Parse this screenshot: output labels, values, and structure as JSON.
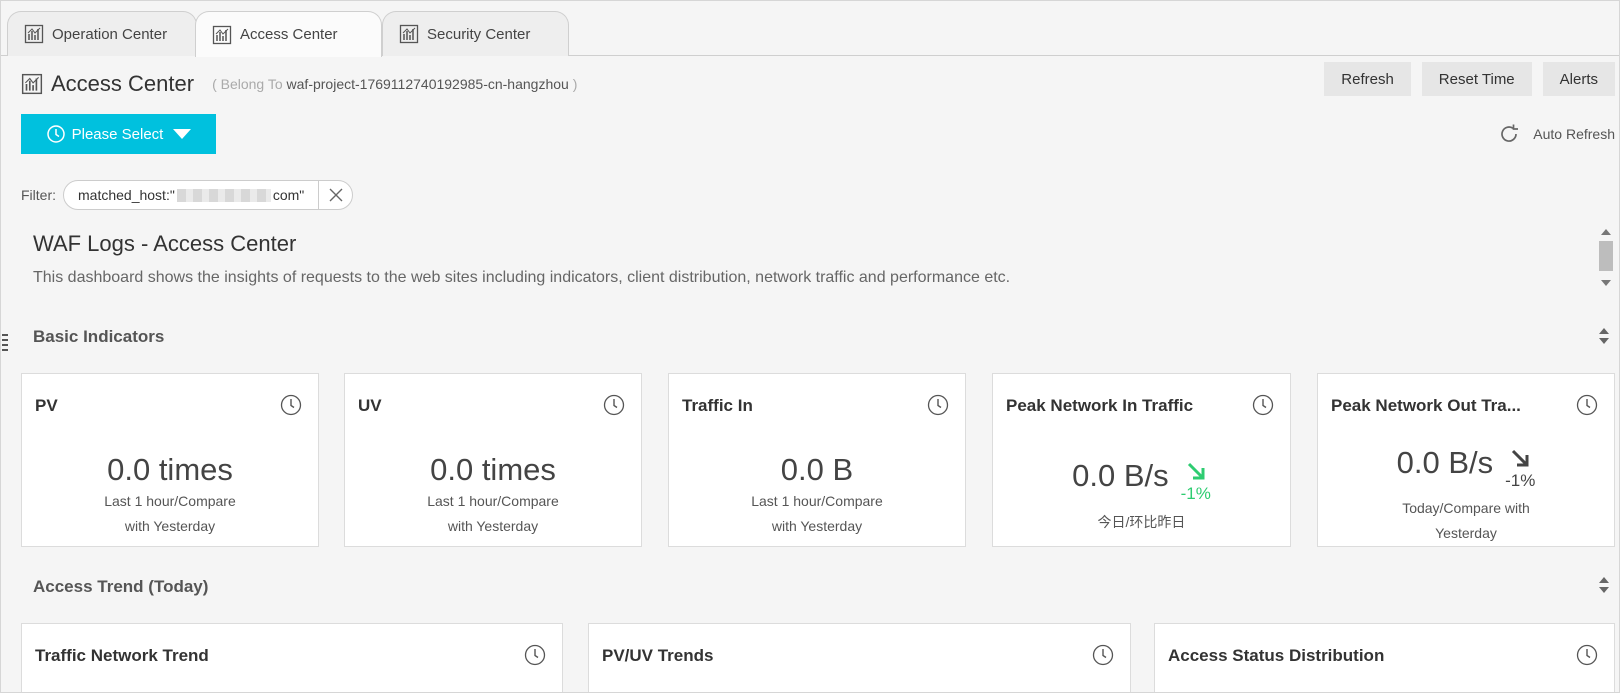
{
  "tabs": [
    {
      "label": "Operation Center",
      "active": false
    },
    {
      "label": "Access Center",
      "active": true
    },
    {
      "label": "Security Center",
      "active": false
    }
  ],
  "header": {
    "title": "Access Center",
    "belong_prefix": "( Belong To",
    "project": "waf-project-1769112740192985-cn-hangzhou",
    "belong_suffix": ")",
    "buttons": {
      "refresh": "Refresh",
      "reset_time": "Reset Time",
      "alerts": "Alerts"
    }
  },
  "time_select": {
    "label": "Please Select"
  },
  "auto_refresh": {
    "label": "Auto Refresh"
  },
  "filter": {
    "label": "Filter:",
    "chip_prefix": "matched_host:\"",
    "chip_suffix": "com\""
  },
  "dashboard": {
    "title": "WAF Logs - Access Center",
    "description": "This dashboard shows the insights of requests to the web sites including indicators, client distribution, network traffic and performance etc."
  },
  "sections": {
    "basic": "Basic Indicators",
    "trend": "Access Trend (Today)"
  },
  "indicators": [
    {
      "title": "PV",
      "value": "0.0 times",
      "sub1": "Last 1 hour/Compare",
      "sub2": "with Yesterday"
    },
    {
      "title": "UV",
      "value": "0.0 times",
      "sub1": "Last 1 hour/Compare",
      "sub2": "with Yesterday"
    },
    {
      "title": "Traffic In",
      "value": "0.0 B",
      "sub1": "Last 1 hour/Compare",
      "sub2": "with Yesterday"
    },
    {
      "title": "Peak Network In Traffic",
      "value": "0.0 B/s",
      "change": "-1%",
      "sub1": "今日/环比昨日",
      "trend_color": "#2ecc71"
    },
    {
      "title": "Peak Network Out Tra...",
      "value": "0.0 B/s",
      "change": "-1%",
      "sub1": "Today/Compare with",
      "sub2": "Yesterday",
      "trend_color": "#444444"
    }
  ],
  "trend_cards": [
    {
      "title": "Traffic Network Trend"
    },
    {
      "title": "PV/UV Trends"
    },
    {
      "title": "Access Status Distribution"
    }
  ],
  "colors": {
    "accent": "#00c1de",
    "up_green": "#2ecc71"
  },
  "icons": {
    "tab": "chart-icon",
    "clock": "clock-icon",
    "refresh": "refresh-icon",
    "close": "close-icon"
  }
}
